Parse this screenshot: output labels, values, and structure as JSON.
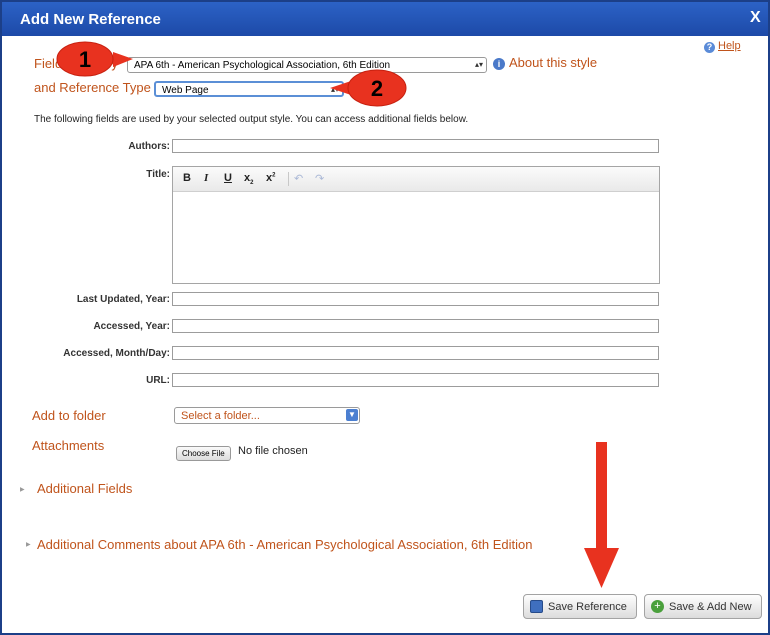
{
  "dialog": {
    "title": "Add New Reference",
    "close_label": "X",
    "help_label": "Help"
  },
  "style_row": {
    "label": "Fields used by",
    "selected_style": "APA 6th - American Psychological Association, 6th Edition",
    "about_label": "About this style"
  },
  "reftype_row": {
    "label": "and Reference Type",
    "selected": "Web Page"
  },
  "description": "The following fields are used by your selected output style. You can access additional fields below.",
  "fields": {
    "authors": "Authors:",
    "title": "Title:",
    "last_updated": "Last Updated, Year:",
    "accessed_year": "Accessed, Year:",
    "accessed_month_day": "Accessed, Month/Day:",
    "url": "URL:"
  },
  "editor_toolbar": {
    "bold": "B",
    "italic": "I",
    "underline": "U",
    "subscript": "x",
    "superscript": "x"
  },
  "folder": {
    "label": "Add to folder",
    "placeholder": "Select a folder..."
  },
  "attachments": {
    "label": "Attachments",
    "choose_label": "Choose File",
    "status": "No file chosen"
  },
  "sections": {
    "additional_fields": "Additional Fields",
    "additional_comments": "Additional Comments about APA 6th - American Psychological Association, 6th Edition"
  },
  "buttons": {
    "save": "Save Reference",
    "save_add_new": "Save & Add New"
  },
  "annotations": {
    "badge_1": "1",
    "badge_2": "2"
  },
  "colors": {
    "accent_orange": "#c0541c",
    "titlebar": "#1d4aa8",
    "annotation_red": "#e8321f"
  }
}
